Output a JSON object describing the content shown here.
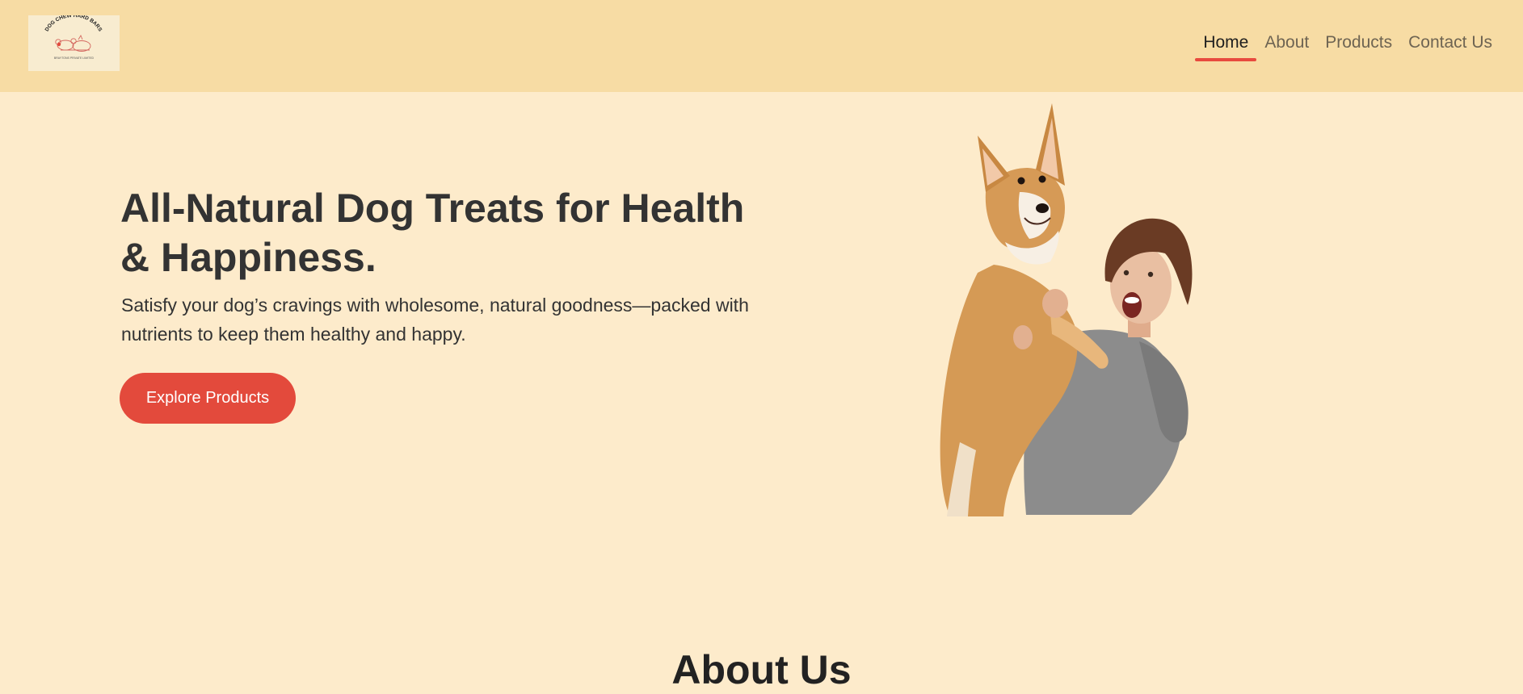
{
  "brand": {
    "logo_text": "DOG CHEW HARD BARS",
    "logo_subtext": "BRAYTONS PRIVATE LIMITED",
    "logo_icon": "dogs-illustration"
  },
  "nav": {
    "items": [
      {
        "label": "Home",
        "active": true
      },
      {
        "label": "About",
        "active": false
      },
      {
        "label": "Products",
        "active": false
      },
      {
        "label": "Contact Us",
        "active": false
      }
    ]
  },
  "hero": {
    "title": "All-Natural Dog Treats for Health & Happiness.",
    "subtitle": "Satisfy your dog’s cravings with wholesome, natural goodness—packed with nutrients to keep them healthy and happy.",
    "cta_label": "Explore Products",
    "image": "woman-holding-corgi"
  },
  "about": {
    "title": "About Us"
  },
  "colors": {
    "header_bg": "#f7dca4",
    "page_bg": "#fdebcb",
    "accent": "#e34a3c",
    "active_indicator": "#e84a3e"
  }
}
